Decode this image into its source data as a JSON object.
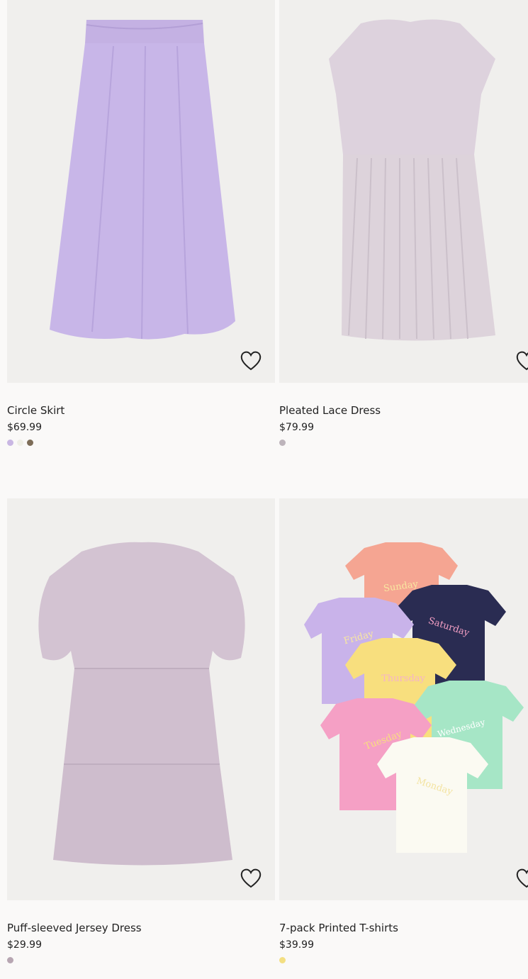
{
  "products": [
    {
      "name": "Circle Skirt",
      "price": "$69.99",
      "swatches": [
        "#c9b7e3",
        "#efefe6",
        "#7d6d58"
      ]
    },
    {
      "name": "Pleated Lace Dress",
      "price": "$79.99",
      "swatches": [
        "#bdb4bb"
      ]
    },
    {
      "name": "Puff-sleeved Jersey Dress",
      "price": "$29.99",
      "swatches": [
        "#b7a6b2"
      ]
    },
    {
      "name": "7-pack Printed T-shirts",
      "price": "$39.99",
      "swatches": [
        "#f3df82"
      ]
    }
  ],
  "tshirt_prints": [
    "Sunday",
    "Saturday",
    "Friday",
    "Thursday",
    "Wednesday",
    "Tuesday",
    "Monday"
  ],
  "icons": {
    "favorite": "heart-icon"
  }
}
